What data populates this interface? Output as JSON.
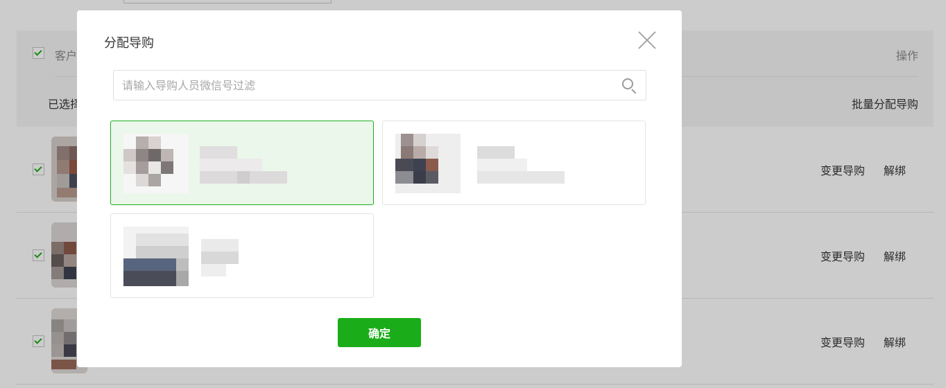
{
  "page": {
    "header": {
      "customer_label": "客户",
      "operation_label": "操作"
    },
    "toolbar": {
      "selected_text": "已选择",
      "batch_assign_label": "批量分配导购"
    },
    "rows": [
      {
        "change_label": "变更导购",
        "unbind_label": "解绑"
      },
      {
        "change_label": "变更导购",
        "unbind_label": "解绑"
      },
      {
        "change_label": "变更导购",
        "unbind_label": "解绑"
      }
    ]
  },
  "dialog": {
    "title": "分配导购",
    "search": {
      "placeholder": "请输入导购人员微信号过滤",
      "value": ""
    },
    "guides": [
      {
        "selected": true,
        "avatar_icon": "pixelated-avatar-icon"
      },
      {
        "selected": false,
        "avatar_icon": "pixelated-avatar-icon"
      },
      {
        "selected": false,
        "avatar_icon": "pixelated-avatar-icon"
      }
    ],
    "confirm_label": "确定"
  },
  "colors": {
    "accent": "#1aad19",
    "selected_card_bg": "#ebf7ea",
    "overlay": "rgba(0,0,0,0.2)"
  }
}
